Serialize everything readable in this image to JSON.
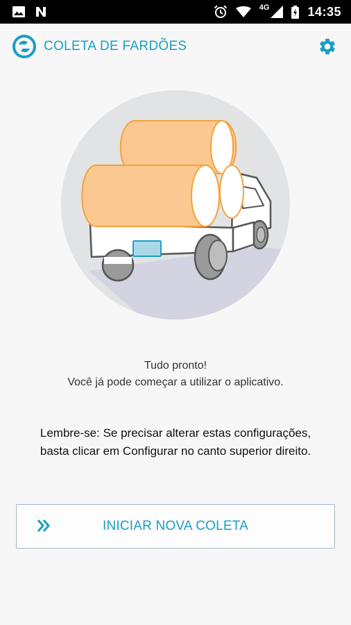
{
  "status_bar": {
    "network": "4G",
    "time": "14:35",
    "icons": [
      "image-icon",
      "n-icon",
      "alarm-icon",
      "wifi-icon",
      "signal-icon",
      "battery-icon"
    ]
  },
  "app_bar": {
    "title": "COLETA DE FARDÕES",
    "logo_icon": "app-logo-icon",
    "settings_icon": "gear-icon"
  },
  "illustration": {
    "icon": "truck-with-bales-illustration"
  },
  "message": {
    "line1": "Tudo pronto!",
    "line2": "Você já pode começar a utilizar o aplicativo."
  },
  "reminder": {
    "line1": "Lembre-se: Se precisar alterar estas configurações,",
    "line2": "basta clicar em Configurar no canto superior direito."
  },
  "start_button": {
    "label": "INICIAR NOVA COLETA",
    "icon": "double-chevron-right-icon"
  },
  "colors": {
    "accent": "#1a9fc1",
    "bale": "#fbc891",
    "bale_stroke": "#f3a33a",
    "circle": "#e2e3e4"
  }
}
